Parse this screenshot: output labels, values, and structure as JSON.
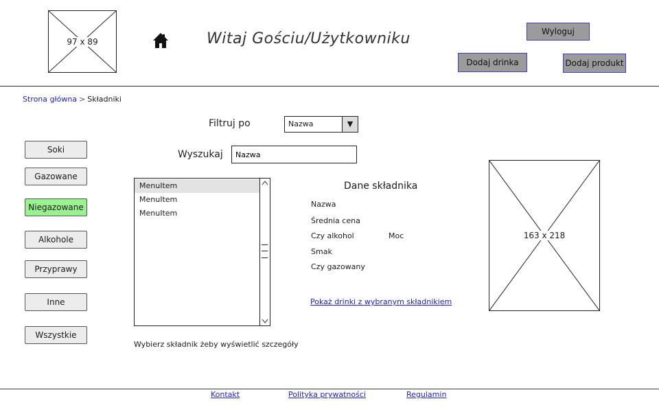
{
  "header": {
    "logo_label": "97 x 89",
    "welcome_text": "Witaj Gościu/Użytkowniku",
    "logout_label": "Wyloguj",
    "add_drink_label": "Dodaj drinka",
    "add_product_label": "Dodaj produkt"
  },
  "breadcrumb": {
    "home": "Strona główna",
    "separator": ">",
    "current": "Składniki"
  },
  "sidebar": {
    "items": [
      {
        "label": "Soki",
        "active": false
      },
      {
        "label": "Gazowane",
        "active": false
      },
      {
        "label": "Niegazowane",
        "active": true
      },
      {
        "label": "Alkohole",
        "active": false
      },
      {
        "label": "Przyprawy",
        "active": false
      },
      {
        "label": "Inne",
        "active": false
      },
      {
        "label": "Wszystkie",
        "active": false
      }
    ]
  },
  "filter": {
    "label": "Filtruj po",
    "selected": "Nazwa",
    "arrow": "▼"
  },
  "search": {
    "label": "Wyszukaj",
    "value": "Nazwa"
  },
  "list": {
    "items": [
      "MenuItem",
      "MenuItem",
      "MenuItem"
    ],
    "hint": "Wybierz składnik żeby wyświetlić szczegóły"
  },
  "details": {
    "title": "Dane składnika",
    "name": "Nazwa",
    "avg_price": "Średnia cena",
    "is_alcohol": "Czy alkohol",
    "strength": "Moc",
    "taste": "Smak",
    "is_carbonated": "Czy gazowany",
    "show_drinks_link": "Pokaż drinki z wybranym składnikiem"
  },
  "image_placeholder": {
    "label": "163 x 218"
  },
  "footer": {
    "contact": "Kontakt",
    "privacy": "Polityka prywatności",
    "terms": "Regulamin"
  },
  "colors": {
    "active_item": "#99f28f",
    "dark_button": "#9b9b9b",
    "link": "#2020cc"
  }
}
